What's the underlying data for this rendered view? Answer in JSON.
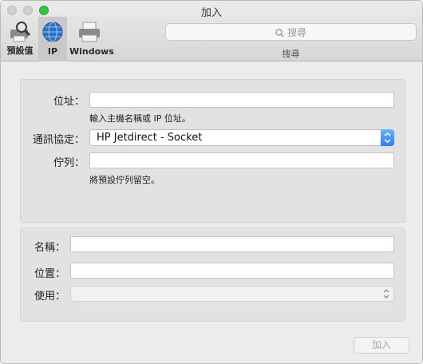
{
  "window": {
    "title": "加入"
  },
  "toolbar": {
    "items": [
      {
        "label": "預設值",
        "icon": "printer-search-icon",
        "selected": false
      },
      {
        "label": "IP",
        "icon": "globe-icon",
        "selected": true
      },
      {
        "label": "Windows",
        "icon": "printer-icon",
        "selected": false
      }
    ],
    "search": {
      "placeholder": "搜尋",
      "label": "搜尋"
    }
  },
  "form": {
    "address": {
      "label": "位址：",
      "value": "",
      "hint": "輸入主機名稱或 IP 位址。"
    },
    "protocol": {
      "label": "通訊協定：",
      "value": "HP Jetdirect - Socket"
    },
    "queue": {
      "label": "佇列：",
      "value": "",
      "hint": "將預設佇列留空。"
    },
    "name": {
      "label": "名稱：",
      "value": ""
    },
    "location": {
      "label": "位置：",
      "value": ""
    },
    "use": {
      "label": "使用：",
      "value": ""
    }
  },
  "footer": {
    "add_label": "加入"
  },
  "colors": {
    "accent": "#2c7ff2",
    "traffic_max": "#2fc844"
  }
}
